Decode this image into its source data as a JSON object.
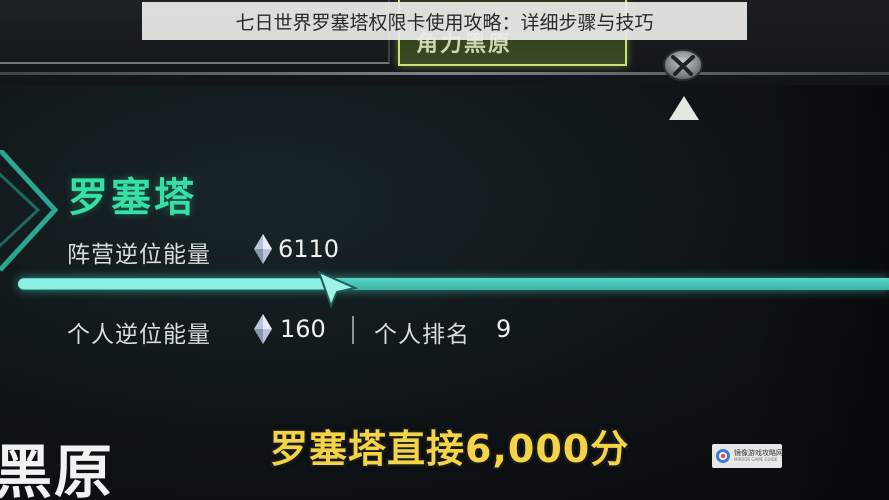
{
  "caption": "七日世界罗塞塔权限卡使用攻略：详细步骤与技巧",
  "top_bar": {
    "highlight_tab_label": "角力黑原"
  },
  "faction_panel": {
    "title": "罗塞塔",
    "faction_energy": {
      "label": "阵营逆位能量",
      "value": "6110"
    },
    "personal_energy": {
      "label": "个人逆位能量",
      "value": "160"
    },
    "personal_rank": {
      "label": "个人排名",
      "value": "9"
    },
    "progress_fraction": 0.36
  },
  "map_region_label": "黑原",
  "subtitle": "罗塞塔直接6,000分",
  "watermark": {
    "cn": "镜像游戏攻略网",
    "en": "MIRROR GAME GUIDE"
  },
  "colors": {
    "accent_teal": "#35e0a4",
    "progress_bar": "#56d7c8",
    "subtitle_yellow": "#f3d447",
    "top_tab_border": "#c8e27a"
  },
  "icons": {
    "energy": "diamond-gem-icon",
    "node": "x-emblem-node-icon",
    "pointer": "up-triangle-icon",
    "cursor": "arrow-cursor-icon"
  }
}
